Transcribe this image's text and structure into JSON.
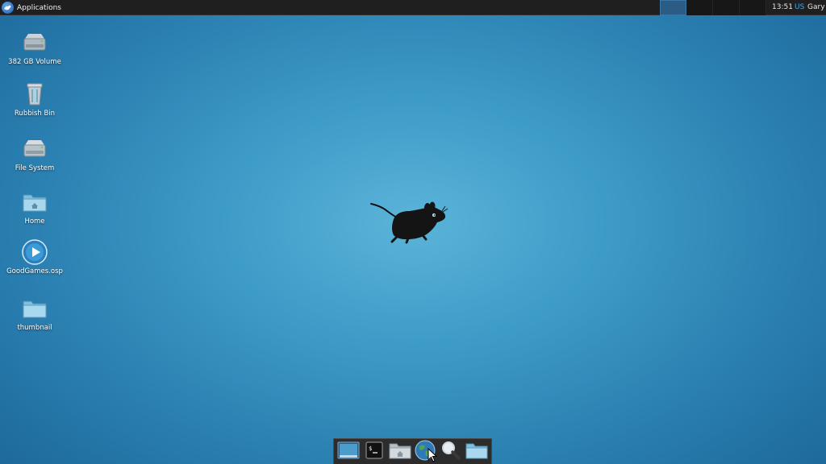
{
  "top_panel": {
    "apps_menu_label": "Applications",
    "workspaces": [
      {
        "active": true
      },
      {
        "active": false
      },
      {
        "active": false
      },
      {
        "active": false
      }
    ],
    "clock": "13:51",
    "keyboard_layout": "US",
    "user": "Gary"
  },
  "desktop": {
    "icons": [
      {
        "label": "382 GB Volume",
        "icon": "drive-icon"
      },
      {
        "label": "Rubbish Bin",
        "icon": "trash-icon"
      },
      {
        "label": "File System",
        "icon": "drive-icon"
      },
      {
        "label": "Home",
        "icon": "home-folder-icon"
      },
      {
        "label": "GoodGames.osp",
        "icon": "media-file-icon"
      },
      {
        "label": "thumbnail",
        "icon": "folder-icon"
      }
    ],
    "wallpaper_logo": "xfce-mouse-logo"
  },
  "dock": {
    "items": [
      {
        "name": "show-desktop",
        "icon": "show-desktop-icon"
      },
      {
        "name": "terminal",
        "icon": "terminal-icon"
      },
      {
        "name": "file-manager",
        "icon": "home-folder-icon"
      },
      {
        "name": "web-browser",
        "icon": "globe-icon"
      },
      {
        "name": "app-finder",
        "icon": "magnifier-icon"
      },
      {
        "name": "folder",
        "icon": "folder-icon"
      }
    ]
  },
  "colors": {
    "panel_bg": "#1f1f1f",
    "accent": "#4ea6e6",
    "desktop_center": "#5bb4d9",
    "desktop_edge": "#1a6195"
  }
}
